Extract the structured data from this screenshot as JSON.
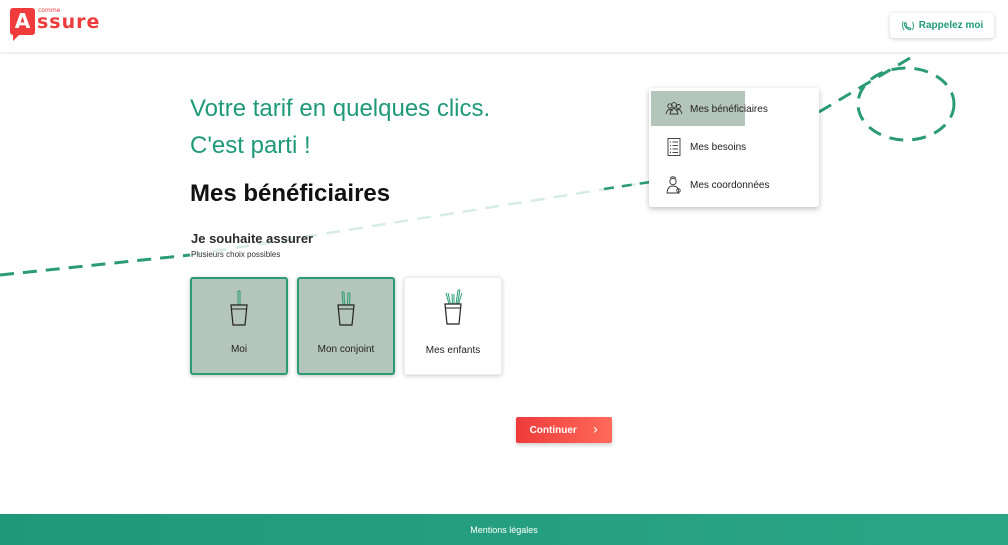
{
  "brand": {
    "logo_letter": "A",
    "logo_small": "comme",
    "logo_word": "ssure",
    "color": "#ef3b3b"
  },
  "header": {
    "callback_label": "Rappelez moi",
    "callback_icon": "phone-ringing-icon"
  },
  "hero": {
    "line1": "Votre tarif en quelques clics.",
    "line2": "C'est parti !",
    "accent_color": "#1f9a78"
  },
  "section": {
    "title": "Mes bénéficiaires",
    "question": "Je souhaite assurer",
    "hint": "Plusieurs choix possibles"
  },
  "options": [
    {
      "label": "Moi",
      "selected": true,
      "icon": "single-toothbrush-cup-icon"
    },
    {
      "label": "Mon conjoint",
      "selected": true,
      "icon": "two-toothbrushes-cup-icon"
    },
    {
      "label": "Mes enfants",
      "selected": false,
      "icon": "many-toothbrushes-cup-icon"
    }
  ],
  "cta": {
    "continue_label": "Continuer",
    "arrow_icon": "chevron-right-icon"
  },
  "steps": [
    {
      "label": "Mes bénéficiaires",
      "icon": "people-group-icon",
      "active": true
    },
    {
      "label": "Mes besoins",
      "icon": "checklist-icon",
      "active": false
    },
    {
      "label": "Mes coordonnées",
      "icon": "person-contact-icon",
      "active": false
    }
  ],
  "footer": {
    "legal_label": "Mentions légales"
  }
}
